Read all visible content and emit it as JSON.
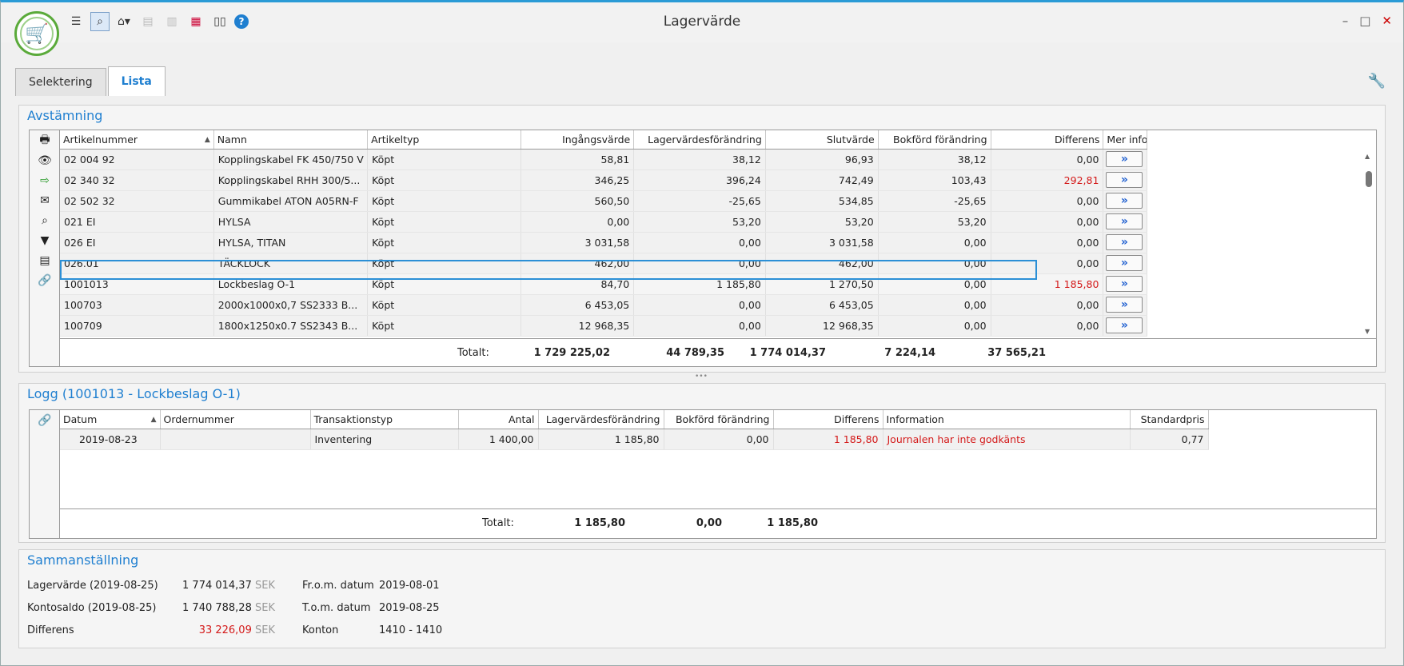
{
  "window": {
    "title": "Lagervärde",
    "minimize": "–",
    "maximize": "□",
    "close": "✕"
  },
  "toolbar": {
    "icons": [
      "list-icon",
      "search-icon",
      "home-icon",
      "page-icon",
      "page2-icon",
      "grid-icon",
      "book-icon",
      "help-icon"
    ],
    "help_label": "?"
  },
  "tabs": [
    {
      "label": "Selektering",
      "active": false
    },
    {
      "label": "Lista",
      "active": true
    }
  ],
  "avstamning": {
    "title": "Avstämning",
    "columns": [
      "Artikelnummer",
      "Namn",
      "Artikeltyp",
      "Ingångsvärde",
      "Lagervärdesförändring",
      "Slutvärde",
      "Bokförd förändring",
      "Differens",
      "Mer info"
    ],
    "rows": [
      [
        "02 004 92",
        "Kopplingskabel FK 450/750 V",
        "Köpt",
        "58,81",
        "38,12",
        "96,93",
        "38,12",
        "0,00"
      ],
      [
        "02 340 32",
        "Kopplingskabel RHH 300/5...",
        "Köpt",
        "346,25",
        "396,24",
        "742,49",
        "103,43",
        "292,81"
      ],
      [
        "02 502 32",
        "Gummikabel ATON A05RN-F",
        "Köpt",
        "560,50",
        "-25,65",
        "534,85",
        "-25,65",
        "0,00"
      ],
      [
        "021 EI",
        "HYLSA",
        "Köpt",
        "0,00",
        "53,20",
        "53,20",
        "53,20",
        "0,00"
      ],
      [
        "026 EI",
        "HYLSA, TITAN",
        "Köpt",
        "3 031,58",
        "0,00",
        "3 031,58",
        "0,00",
        "0,00"
      ],
      [
        "026.01",
        "TÄCKLOCK",
        "Köpt",
        "462,00",
        "0,00",
        "462,00",
        "0,00",
        "0,00"
      ],
      [
        "1001013",
        "Lockbeslag O-1",
        "Köpt",
        "84,70",
        "1 185,80",
        "1 270,50",
        "0,00",
        "1 185,80"
      ],
      [
        "100703",
        "2000x1000x0,7 SS2333 B...",
        "Köpt",
        "6 453,05",
        "0,00",
        "6 453,05",
        "0,00",
        "0,00"
      ],
      [
        "100709",
        "1800x1250x0.7 SS2343 B...",
        "Köpt",
        "12 968,35",
        "0,00",
        "12 968,35",
        "0,00",
        "0,00"
      ]
    ],
    "red_rows": [
      1,
      6
    ],
    "selected_row": 6,
    "more_label": "»",
    "totals": {
      "label": "Totalt:",
      "ingangsvarde": "1 729 225,02",
      "lagervardesforandring": "44 789,35",
      "slutvarde": "1 774 014,37",
      "bokford": "7 224,14",
      "differens": "37 565,21"
    }
  },
  "splitter": "•••",
  "logg": {
    "title": "Logg (1001013 - Lockbeslag O-1)",
    "columns": [
      "Datum",
      "Ordernummer",
      "Transaktionstyp",
      "Antal",
      "Lagervärdesförändring",
      "Bokförd förändring",
      "Differens",
      "Information",
      "Standardpris"
    ],
    "rows": [
      [
        "2019-08-23",
        "",
        "Inventering",
        "1 400,00",
        "1 185,80",
        "0,00",
        "1 185,80",
        "Journalen har inte godkänts",
        "0,77"
      ]
    ],
    "totals": {
      "label": "Totalt:",
      "lagervardesforandring": "1 185,80",
      "bokford": "0,00",
      "differens": "1 185,80"
    }
  },
  "sammanstallning": {
    "title": "Sammanställning",
    "rows": [
      {
        "label": "Lagervärde (2019-08-25)",
        "value": "1 774 014,37",
        "unit": "SEK",
        "label2": "Fr.o.m. datum",
        "value2": "2019-08-01"
      },
      {
        "label": "Kontosaldo (2019-08-25)",
        "value": "1 740 788,28",
        "unit": "SEK",
        "label2": "T.o.m. datum",
        "value2": "2019-08-25"
      },
      {
        "label": "Differens",
        "value": "33 226,09",
        "unit": "SEK",
        "label2": "Konton",
        "value2": "1410 - 1410"
      }
    ]
  },
  "colors": {
    "accent": "#1f7fd0",
    "red": "#d41a1a",
    "logo_green": "#5aaa3a"
  }
}
